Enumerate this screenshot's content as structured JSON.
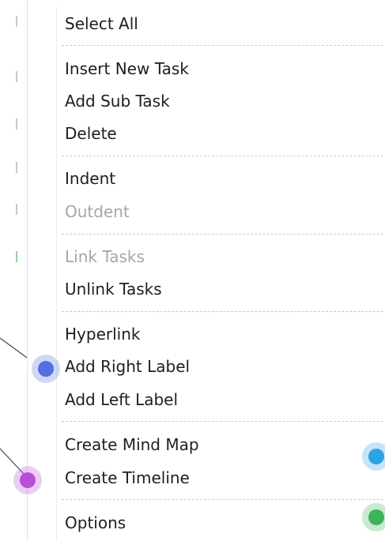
{
  "menu": {
    "items": [
      {
        "label": "Select All",
        "enabled": true
      },
      {
        "label": "Insert New Task",
        "enabled": true
      },
      {
        "label": "Add Sub Task",
        "enabled": true
      },
      {
        "label": "Delete",
        "enabled": true
      },
      {
        "label": "Indent",
        "enabled": true
      },
      {
        "label": "Outdent",
        "enabled": false
      },
      {
        "label": "Link Tasks",
        "enabled": false
      },
      {
        "label": "Unlink Tasks",
        "enabled": true
      },
      {
        "label": "Hyperlink",
        "enabled": true
      },
      {
        "label": "Add Right Label",
        "enabled": true
      },
      {
        "label": "Add Left Label",
        "enabled": true
      },
      {
        "label": "Create Mind Map",
        "enabled": true
      },
      {
        "label": "Create Timeline",
        "enabled": true
      },
      {
        "label": "Options",
        "enabled": true
      }
    ]
  },
  "markers": {
    "blue": "#5470e0",
    "purple": "#b84fd6",
    "cyan": "#2ba3e6",
    "green": "#3db35a"
  },
  "colors": {
    "text": "#1e1e1e",
    "disabled_text": "#a6a6a6",
    "separator": "#c9c9c9"
  }
}
